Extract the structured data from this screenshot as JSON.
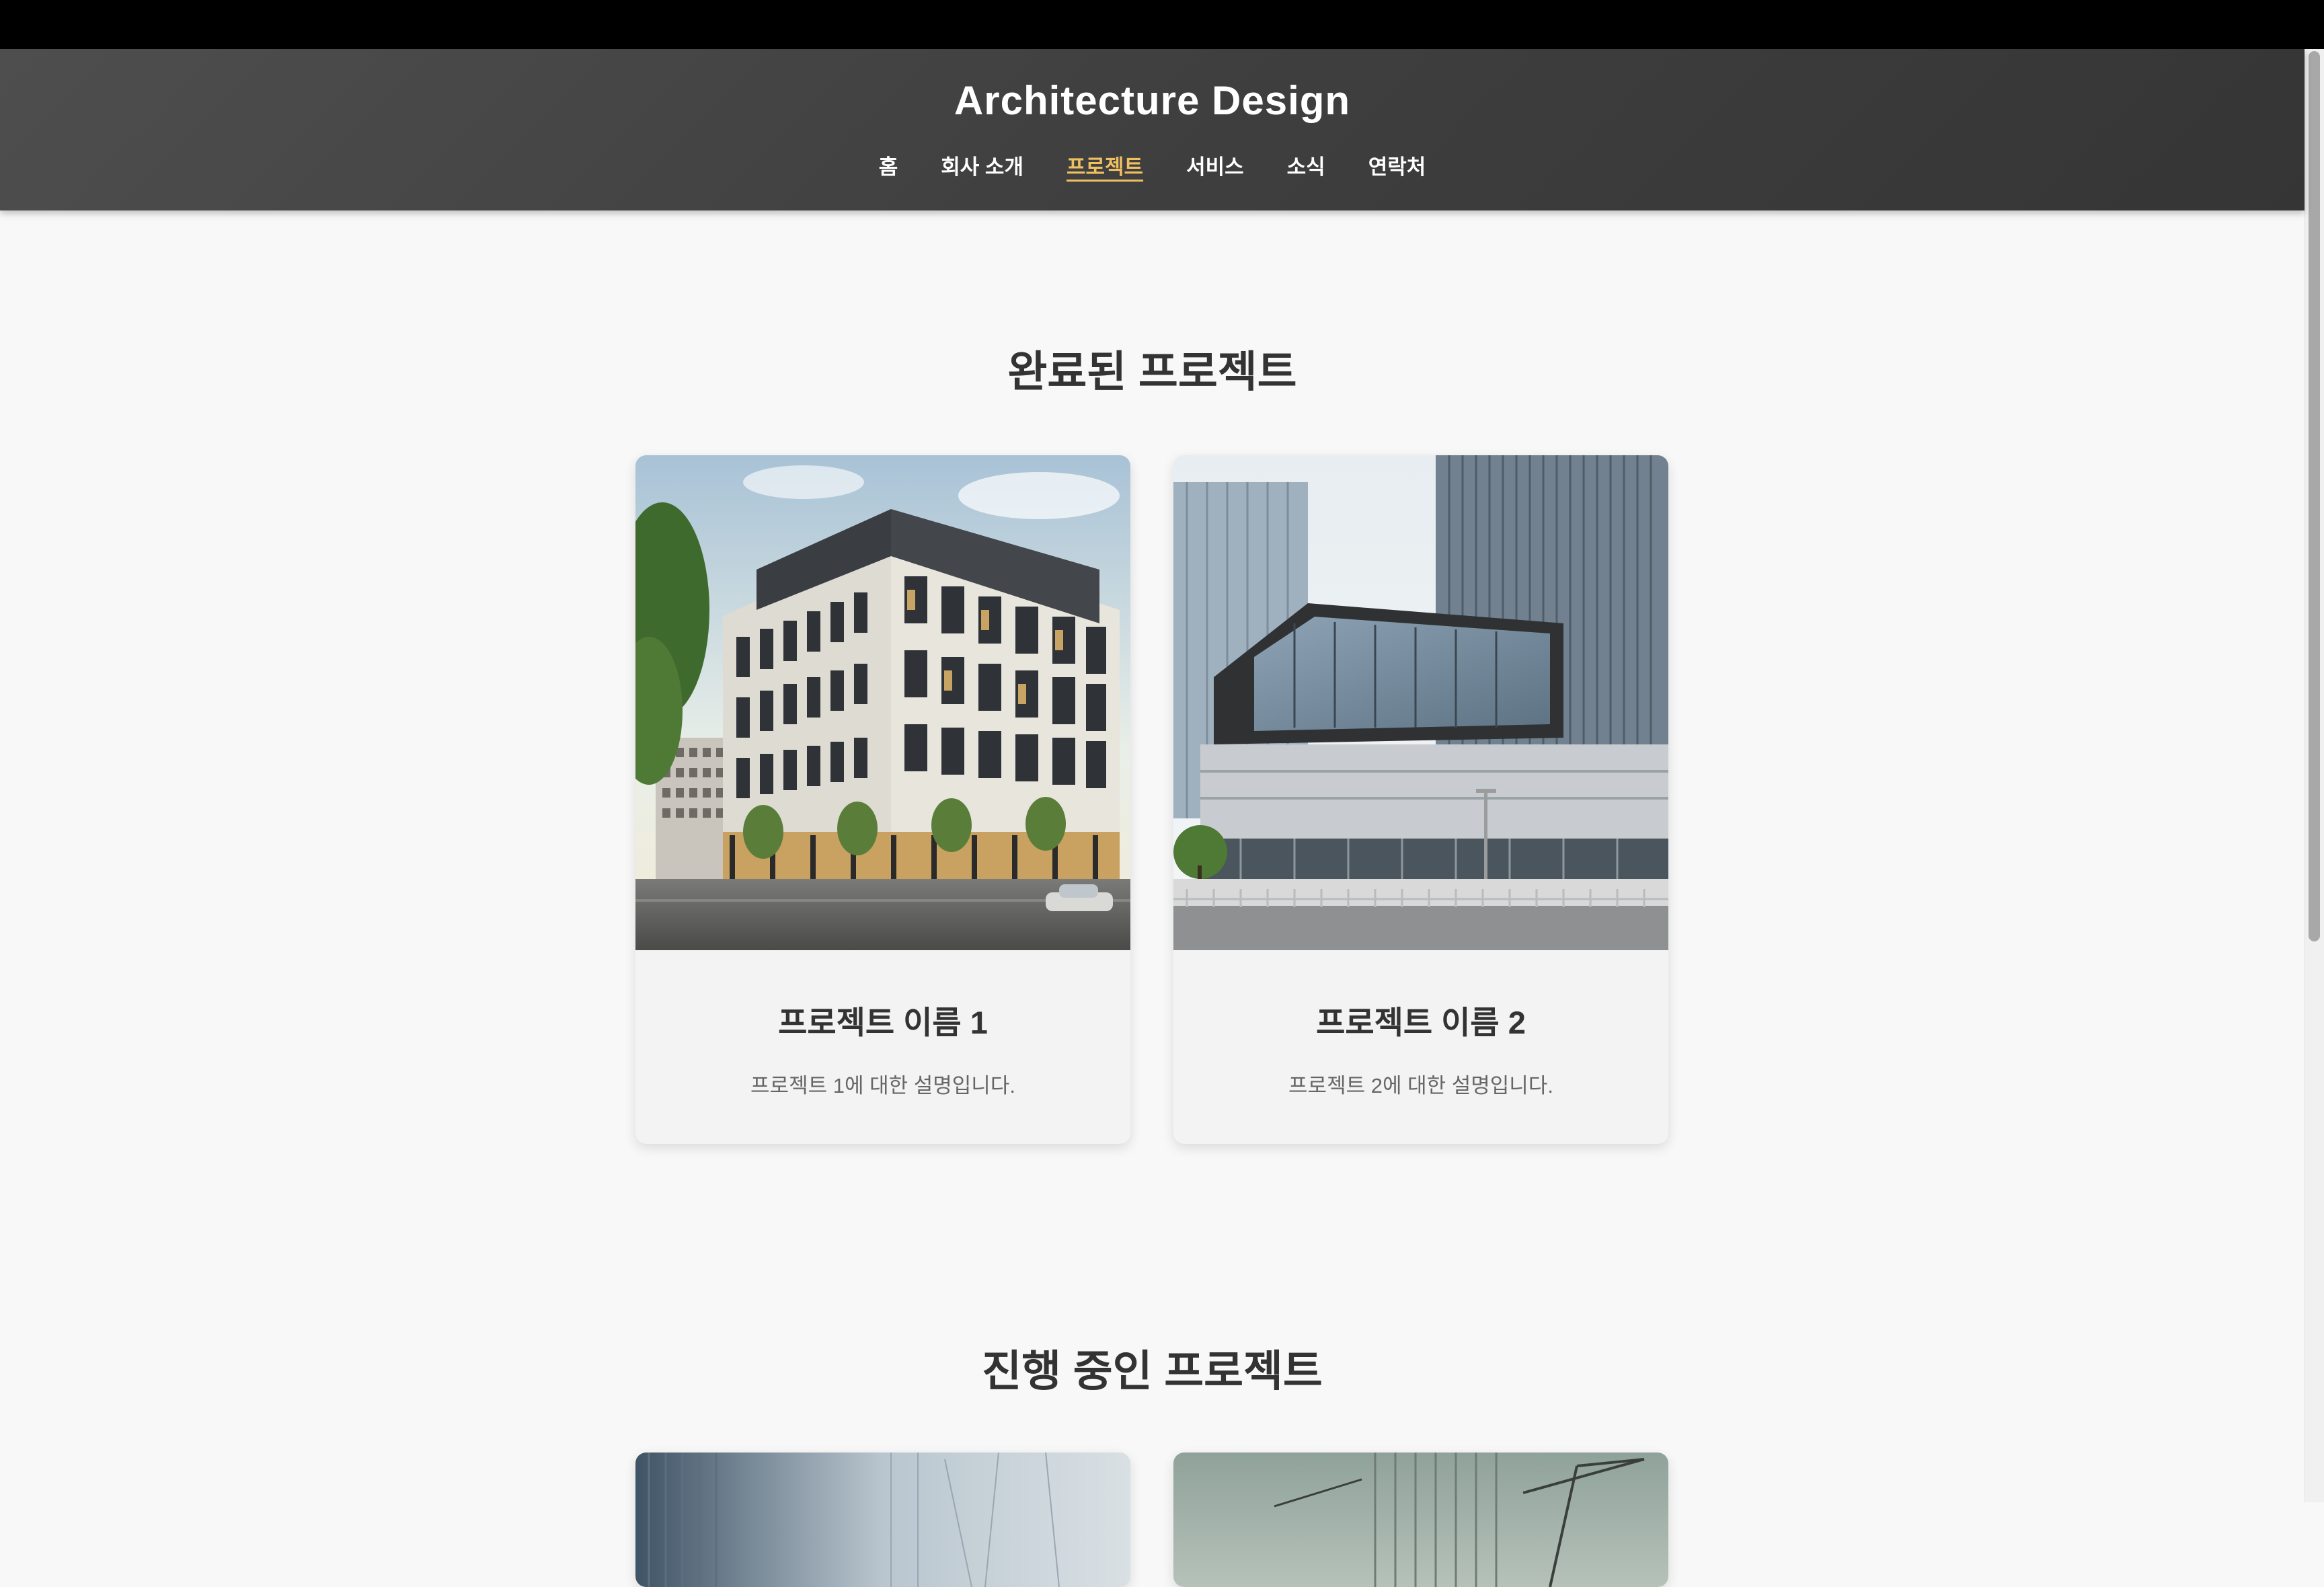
{
  "site": {
    "title": "Architecture Design"
  },
  "nav": {
    "items": [
      {
        "label": "홈"
      },
      {
        "label": "회사 소개"
      },
      {
        "label": "프로젝트",
        "active": true
      },
      {
        "label": "서비스"
      },
      {
        "label": "소식"
      },
      {
        "label": "연락처"
      }
    ]
  },
  "colors": {
    "header": "#444444",
    "active_nav": "#f0c060",
    "background": "#f8f8f8",
    "card": "#f3f3f3"
  },
  "sections": [
    {
      "title": "완료된 프로젝트",
      "projects": [
        {
          "name": "프로젝트 이름 1",
          "description": "프로젝트 1에 대한 설명입니다."
        },
        {
          "name": "프로젝트 이름 2",
          "description": "프로젝트 2에 대한 설명입니다."
        }
      ]
    },
    {
      "title": "진행 중인 프로젝트"
    }
  ]
}
